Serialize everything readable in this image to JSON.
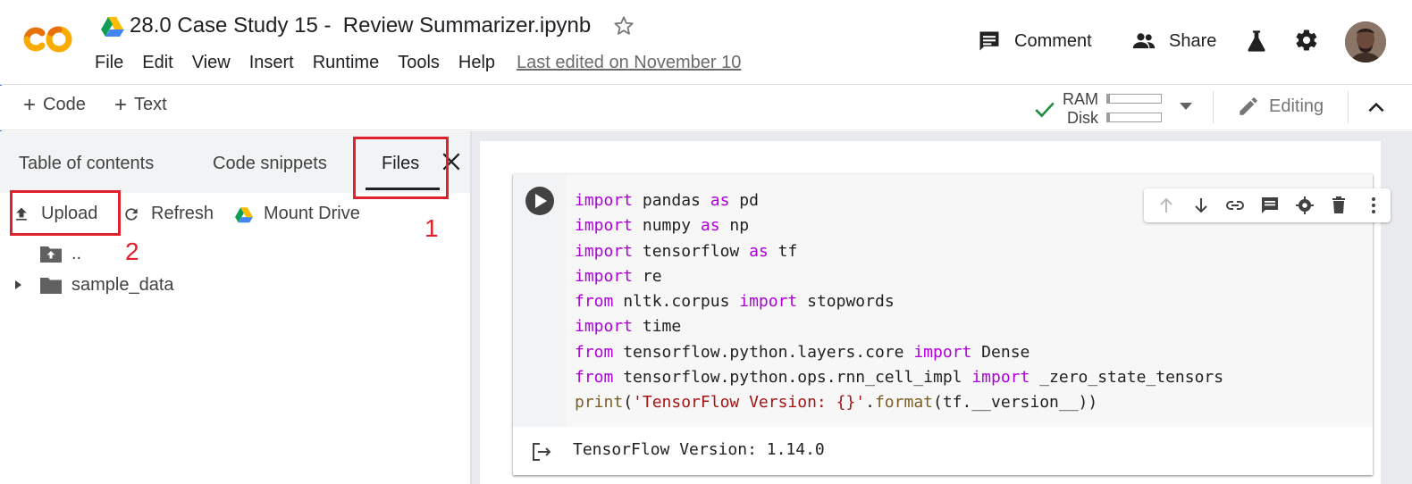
{
  "app": {
    "logo_text": "CO",
    "notebook_title": "28.0 Case Study 15 -  Review Summarizer.ipynb",
    "menu": [
      "File",
      "Edit",
      "View",
      "Insert",
      "Runtime",
      "Tools",
      "Help"
    ],
    "last_edited": "Last edited on November 10",
    "header_buttons": {
      "comment": "Comment",
      "share": "Share"
    }
  },
  "toolbar": {
    "add_code": "Code",
    "add_text": "Text",
    "resources": {
      "ram_label": "RAM",
      "disk_label": "Disk",
      "ram_usage": 0.05,
      "disk_usage": 0.05,
      "status": "connected"
    },
    "editing": "Editing"
  },
  "side_panel": {
    "tabs": [
      "Table of contents",
      "Code snippets",
      "Files"
    ],
    "active_tab": "Files",
    "actions": {
      "upload": "Upload",
      "refresh": "Refresh",
      "mount": "Mount Drive"
    },
    "tree": [
      {
        "name": "..",
        "type": "parent-folder"
      },
      {
        "name": "sample_data",
        "type": "folder",
        "expanded": false
      }
    ]
  },
  "annotations": {
    "num1": "1",
    "num2": "2",
    "color": "#e0202c"
  },
  "cell": {
    "code_lines": [
      [
        [
          "kw",
          "import"
        ],
        [
          "t",
          " pandas "
        ],
        [
          "kw",
          "as"
        ],
        [
          "t",
          " pd"
        ]
      ],
      [
        [
          "kw",
          "import"
        ],
        [
          "t",
          " numpy "
        ],
        [
          "kw",
          "as"
        ],
        [
          "t",
          " np"
        ]
      ],
      [
        [
          "kw",
          "import"
        ],
        [
          "t",
          " tensorflow "
        ],
        [
          "kw",
          "as"
        ],
        [
          "t",
          " tf"
        ]
      ],
      [
        [
          "kw",
          "import"
        ],
        [
          "t",
          " re"
        ]
      ],
      [
        [
          "kw",
          "from"
        ],
        [
          "t",
          " nltk.corpus "
        ],
        [
          "kw",
          "import"
        ],
        [
          "t",
          " stopwords"
        ]
      ],
      [
        [
          "kw",
          "import"
        ],
        [
          "t",
          " time"
        ]
      ],
      [
        [
          "kw",
          "from"
        ],
        [
          "t",
          " tensorflow.python.layers.core "
        ],
        [
          "kw",
          "import"
        ],
        [
          "t",
          " Dense"
        ]
      ],
      [
        [
          "kw",
          "from"
        ],
        [
          "t",
          " tensorflow.python.ops.rnn_cell_impl "
        ],
        [
          "kw",
          "import"
        ],
        [
          "t",
          " _zero_state_tensors"
        ]
      ],
      [
        [
          "fn",
          "print"
        ],
        [
          "t",
          "("
        ],
        [
          "str",
          "'TensorFlow Version: {}'"
        ],
        [
          "t",
          "."
        ],
        [
          "fn",
          "format"
        ],
        [
          "t",
          "(tf.__version__))"
        ]
      ]
    ],
    "output": "TensorFlow Version: 1.14.0"
  },
  "colors": {
    "keyword": "#af00db",
    "function": "#795e26",
    "string": "#a31515",
    "logo_orange": "#f9ab00",
    "logo_dark_orange": "#e8710a"
  }
}
